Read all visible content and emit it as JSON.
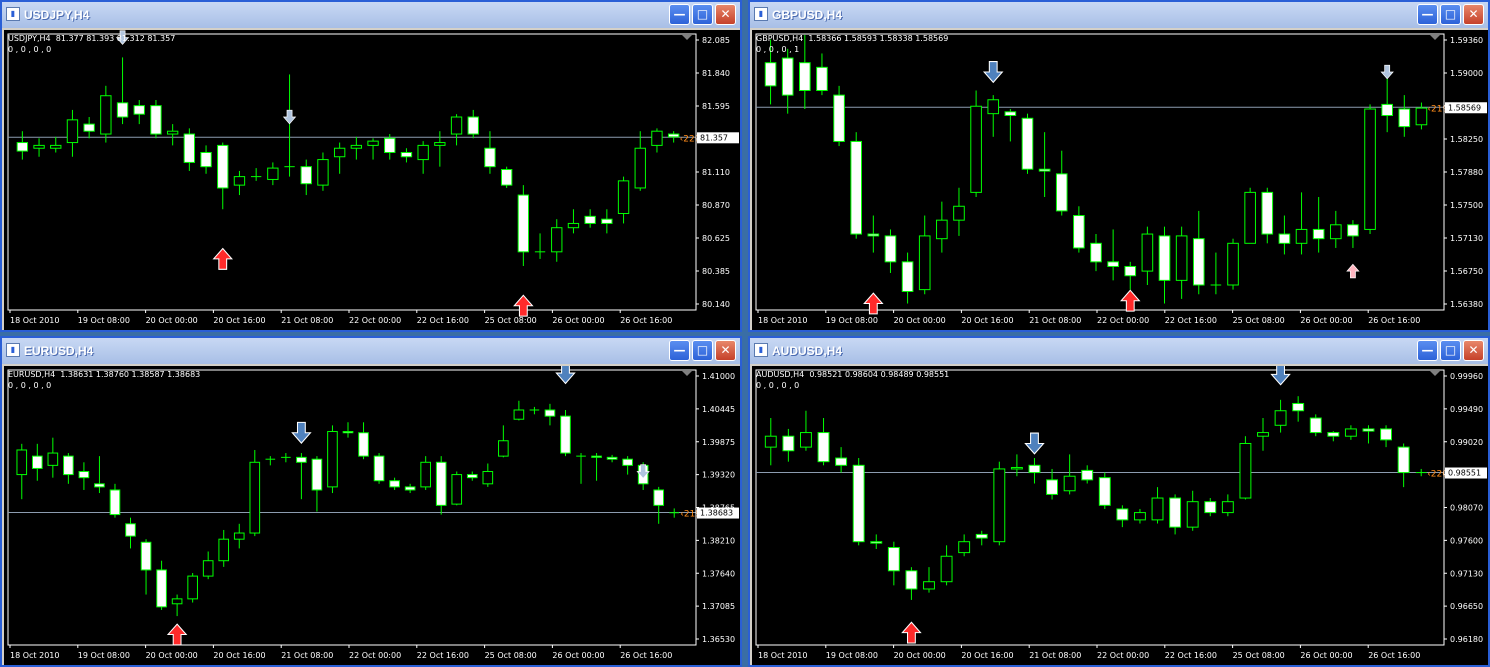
{
  "windows": [
    {
      "title": "USDJPY,H4",
      "symbol_line": "USDJPY,H4  81.377 81.393 81.312 81.357",
      "indicator_line": "0 , 0 , 0 , 0",
      "yticks": [
        "82.085",
        "81.840",
        "81.595",
        "81.350",
        "81.110",
        "80.870",
        "80.625",
        "80.385",
        "80.140"
      ],
      "ymin": 80.14,
      "ymax": 82.085,
      "price_label": "81.357",
      "price": 81.357,
      "timer": "220:00",
      "xticks": [
        "18 Oct 2010",
        "19 Oct 08:00",
        "20 Oct 00:00",
        "20 Oct 16:00",
        "21 Oct 08:00",
        "22 Oct 00:00",
        "22 Oct 16:00",
        "25 Oct 08:00",
        "26 Oct 00:00",
        "26 Oct 16:00"
      ],
      "candles": [
        [
          81.32,
          81.26,
          81.4,
          81.2
        ],
        [
          81.28,
          81.3,
          81.35,
          81.22
        ],
        [
          81.28,
          81.3,
          81.36,
          81.25
        ],
        [
          81.32,
          81.48,
          81.55,
          81.22
        ],
        [
          81.45,
          81.4,
          81.5,
          81.35
        ],
        [
          81.38,
          81.65,
          81.72,
          81.32
        ],
        [
          81.6,
          81.5,
          81.92,
          81.45
        ],
        [
          81.58,
          81.52,
          81.62,
          81.45
        ],
        [
          81.58,
          81.38,
          81.62,
          81.35
        ],
        [
          81.38,
          81.4,
          81.45,
          81.3
        ],
        [
          81.38,
          81.18,
          81.42,
          81.12
        ],
        [
          81.25,
          81.15,
          81.3,
          81.1
        ],
        [
          81.3,
          81.0,
          81.32,
          80.85
        ],
        [
          81.02,
          81.08,
          81.12,
          80.95
        ],
        [
          81.08,
          81.08,
          81.14,
          81.05
        ],
        [
          81.06,
          81.14,
          81.18,
          81.02
        ],
        [
          81.15,
          81.15,
          81.8,
          81.08
        ],
        [
          81.15,
          81.03,
          81.2,
          80.95
        ],
        [
          81.02,
          81.2,
          81.25,
          80.98
        ],
        [
          81.22,
          81.28,
          81.32,
          81.1
        ],
        [
          81.28,
          81.3,
          81.36,
          81.2
        ],
        [
          81.3,
          81.33,
          81.35,
          81.2
        ],
        [
          81.35,
          81.25,
          81.38,
          81.2
        ],
        [
          81.25,
          81.22,
          81.28,
          81.18
        ],
        [
          81.2,
          81.3,
          81.33,
          81.1
        ],
        [
          81.3,
          81.32,
          81.4,
          81.15
        ],
        [
          81.38,
          81.5,
          81.52,
          81.3
        ],
        [
          81.5,
          81.38,
          81.55,
          81.35
        ],
        [
          81.28,
          81.15,
          81.4,
          81.1
        ],
        [
          81.13,
          81.02,
          81.15,
          81.0
        ],
        [
          80.95,
          80.55,
          81.02,
          80.45
        ],
        [
          80.55,
          80.55,
          80.68,
          80.5
        ],
        [
          80.55,
          80.72,
          80.78,
          80.48
        ],
        [
          80.72,
          80.75,
          80.85,
          80.68
        ],
        [
          80.8,
          80.75,
          80.85,
          80.72
        ],
        [
          80.78,
          80.75,
          80.85,
          80.68
        ],
        [
          80.82,
          81.05,
          81.08,
          80.75
        ],
        [
          81.0,
          81.28,
          81.4,
          80.98
        ],
        [
          81.3,
          81.4,
          81.42,
          81.25
        ],
        [
          81.38,
          81.36,
          81.4,
          81.32
        ]
      ],
      "arrows": [
        {
          "i": 6,
          "dir": "down",
          "color": "#b0c4de",
          "big": false,
          "p": 82.06
        },
        {
          "i": 16,
          "dir": "down",
          "color": "#b0c4de",
          "big": false,
          "p": 81.5
        },
        {
          "i": 12,
          "dir": "up",
          "color": "#ff2a2a",
          "big": true,
          "p": 80.5
        },
        {
          "i": 30,
          "dir": "up",
          "color": "#ff2a2a",
          "big": true,
          "p": 80.17
        }
      ]
    },
    {
      "title": "GBPUSD,H4",
      "symbol_line": "GBPUSD,H4  1.58366 1.58593 1.58338 1.58569",
      "indicator_line": "0 , 0 , 0 , 1",
      "yticks": [
        "1.59360",
        "1.59000",
        "1.58569",
        "1.58250",
        "1.57880",
        "1.57500",
        "1.57130",
        "1.56750",
        "1.56380"
      ],
      "ymin": 1.5638,
      "ymax": 1.5936,
      "price_label": "1.58569",
      "price": 1.58569,
      "timer": "219:59",
      "xticks": [
        "18 Oct 2010",
        "19 Oct 08:00",
        "20 Oct 00:00",
        "20 Oct 16:00",
        "21 Oct 08:00",
        "22 Oct 00:00",
        "22 Oct 16:00",
        "25 Oct 08:00",
        "26 Oct 00:00",
        "26 Oct 16:00"
      ],
      "candles": [
        [
          1.5905,
          1.588,
          1.593,
          1.586
        ],
        [
          1.591,
          1.587,
          1.592,
          1.585
        ],
        [
          1.5905,
          1.5875,
          1.5935,
          1.5855
        ],
        [
          1.59,
          1.5875,
          1.5915,
          1.587
        ],
        [
          1.587,
          1.582,
          1.588,
          1.5815
        ],
        [
          1.582,
          1.572,
          1.583,
          1.5715
        ],
        [
          1.572,
          1.5718,
          1.574,
          1.57
        ],
        [
          1.5718,
          1.569,
          1.5725,
          1.5678
        ],
        [
          1.569,
          1.5658,
          1.57,
          1.5645
        ],
        [
          1.566,
          1.5718,
          1.574,
          1.5655
        ],
        [
          1.5715,
          1.5735,
          1.5755,
          1.57
        ],
        [
          1.5735,
          1.575,
          1.577,
          1.5718
        ],
        [
          1.5765,
          1.5858,
          1.5875,
          1.576
        ],
        [
          1.585,
          1.5865,
          1.587,
          1.5825
        ],
        [
          1.5852,
          1.5848,
          1.5855,
          1.582
        ],
        [
          1.5845,
          1.579,
          1.585,
          1.5785
        ],
        [
          1.579,
          1.5788,
          1.583,
          1.576
        ],
        [
          1.5785,
          1.5745,
          1.581,
          1.574
        ],
        [
          1.574,
          1.5705,
          1.575,
          1.57
        ],
        [
          1.571,
          1.569,
          1.572,
          1.568
        ],
        [
          1.569,
          1.5685,
          1.5725,
          1.567
        ],
        [
          1.5685,
          1.5675,
          1.569,
          1.566
        ],
        [
          1.568,
          1.572,
          1.5728,
          1.5665
        ],
        [
          1.5718,
          1.567,
          1.5728,
          1.5645
        ],
        [
          1.567,
          1.5718,
          1.5728,
          1.565
        ],
        [
          1.5715,
          1.5665,
          1.5745,
          1.5655
        ],
        [
          1.5665,
          1.5665,
          1.57,
          1.5655
        ],
        [
          1.5665,
          1.571,
          1.5715,
          1.566
        ],
        [
          1.571,
          1.5765,
          1.577,
          1.571
        ],
        [
          1.5765,
          1.572,
          1.577,
          1.571
        ],
        [
          1.572,
          1.571,
          1.574,
          1.5698
        ],
        [
          1.571,
          1.5725,
          1.5765,
          1.5698
        ],
        [
          1.5725,
          1.5715,
          1.576,
          1.57
        ],
        [
          1.5715,
          1.573,
          1.5745,
          1.5705
        ],
        [
          1.573,
          1.5718,
          1.5735,
          1.5705
        ],
        [
          1.5725,
          1.5855,
          1.586,
          1.572
        ],
        [
          1.586,
          1.5848,
          1.5895,
          1.583
        ],
        [
          1.5855,
          1.5836,
          1.587,
          1.5825
        ],
        [
          1.5838,
          1.5856,
          1.5862,
          1.5833
        ]
      ],
      "arrows": [
        {
          "i": 13,
          "dir": "down",
          "color": "#4f81bd",
          "big": true,
          "p": 1.5895
        },
        {
          "i": 36,
          "dir": "down",
          "color": "#b0c4de",
          "big": false,
          "p": 1.5895
        },
        {
          "i": 6,
          "dir": "up",
          "color": "#ff2a2a",
          "big": true,
          "p": 1.5645
        },
        {
          "i": 21,
          "dir": "up",
          "color": "#ff2a2a",
          "big": true,
          "p": 1.5648
        },
        {
          "i": 34,
          "dir": "up",
          "color": "#ffb6c1",
          "big": false,
          "p": 1.568
        }
      ]
    },
    {
      "title": "EURUSD,H4",
      "symbol_line": "EURUSD,H4  1.38631 1.38760 1.38587 1.38683",
      "indicator_line": "0 , 0 , 0 , 0",
      "yticks": [
        "1.41000",
        "1.40445",
        "1.39875",
        "1.39320",
        "1.38765",
        "1.38210",
        "1.37640",
        "1.37085",
        "1.36530"
      ],
      "ymin": 1.3653,
      "ymax": 1.41,
      "price_label": "1.38683",
      "price": 1.38683,
      "timer": "219:59",
      "xticks": [
        "18 Oct 2010",
        "19 Oct 08:00",
        "20 Oct 00:00",
        "20 Oct 16:00",
        "21 Oct 08:00",
        "22 Oct 00:00",
        "22 Oct 16:00",
        "25 Oct 08:00",
        "26 Oct 00:00",
        "26 Oct 16:00"
      ],
      "candles": [
        [
          1.393,
          1.397,
          1.398,
          1.389
        ],
        [
          1.396,
          1.394,
          1.398,
          1.392
        ],
        [
          1.3945,
          1.3965,
          1.399,
          1.3925
        ],
        [
          1.396,
          1.393,
          1.3965,
          1.3915
        ],
        [
          1.3935,
          1.3925,
          1.395,
          1.3905
        ],
        [
          1.3915,
          1.391,
          1.396,
          1.39
        ],
        [
          1.3905,
          1.3865,
          1.3915,
          1.386
        ],
        [
          1.385,
          1.383,
          1.386,
          1.381
        ],
        [
          1.382,
          1.3775,
          1.3825,
          1.3735
        ],
        [
          1.3775,
          1.3715,
          1.379,
          1.371
        ],
        [
          1.372,
          1.3728,
          1.3735,
          1.37
        ],
        [
          1.3728,
          1.3765,
          1.377,
          1.3722
        ],
        [
          1.3765,
          1.379,
          1.3805,
          1.376
        ],
        [
          1.379,
          1.3825,
          1.384,
          1.378
        ],
        [
          1.3825,
          1.3835,
          1.385,
          1.381
        ],
        [
          1.3835,
          1.395,
          1.397,
          1.383
        ],
        [
          1.3955,
          1.3955,
          1.396,
          1.3945
        ],
        [
          1.3958,
          1.3958,
          1.3965,
          1.395
        ],
        [
          1.3958,
          1.395,
          1.3965,
          1.389
        ],
        [
          1.3955,
          1.3905,
          1.396,
          1.387
        ],
        [
          1.391,
          1.4,
          1.401,
          1.39
        ],
        [
          1.4,
          1.3998,
          1.4015,
          1.399
        ],
        [
          1.3998,
          1.396,
          1.4015,
          1.3955
        ],
        [
          1.396,
          1.392,
          1.3965,
          1.3915
        ],
        [
          1.392,
          1.391,
          1.3925,
          1.3905
        ],
        [
          1.391,
          1.3905,
          1.3915,
          1.39
        ],
        [
          1.391,
          1.395,
          1.396,
          1.3905
        ],
        [
          1.395,
          1.388,
          1.396,
          1.3865
        ],
        [
          1.3882,
          1.393,
          1.3935,
          1.388
        ],
        [
          1.393,
          1.3925,
          1.3935,
          1.392
        ],
        [
          1.3915,
          1.3935,
          1.3948,
          1.391
        ],
        [
          1.396,
          1.3985,
          1.401,
          1.3958
        ],
        [
          1.402,
          1.4035,
          1.405,
          1.4018
        ],
        [
          1.4035,
          1.4035,
          1.404,
          1.4028
        ],
        [
          1.4035,
          1.4025,
          1.4045,
          1.401
        ],
        [
          1.4025,
          1.3965,
          1.4035,
          1.396
        ],
        [
          1.396,
          1.396,
          1.3965,
          1.3915
        ],
        [
          1.396,
          1.3958,
          1.3965,
          1.392
        ],
        [
          1.3958,
          1.3955,
          1.3962,
          1.395
        ],
        [
          1.3955,
          1.3945,
          1.396,
          1.393
        ],
        [
          1.3945,
          1.3915,
          1.395,
          1.3905
        ],
        [
          1.3905,
          1.388,
          1.391,
          1.385
        ],
        [
          1.3868,
          1.3868,
          1.3875,
          1.386
        ]
      ],
      "arrows": [
        {
          "i": 18,
          "dir": "down",
          "color": "#4f81bd",
          "big": true,
          "p": 1.3998
        },
        {
          "i": 35,
          "dir": "down",
          "color": "#4f81bd",
          "big": true,
          "p": 1.4095
        },
        {
          "i": 40,
          "dir": "down",
          "color": "#b0c4de",
          "big": false,
          "p": 1.3935
        },
        {
          "i": 10,
          "dir": "up",
          "color": "#ff2a2a",
          "big": true,
          "p": 1.367
        }
      ]
    },
    {
      "title": "AUDUSD,H4",
      "symbol_line": "AUDUSD,H4  0.98521 0.98604 0.98489 0.98551",
      "indicator_line": "0 , 0 , 0 , 0",
      "yticks": [
        "0.99960",
        "0.99490",
        "0.99020",
        "0.98551",
        "0.98070",
        "0.97600",
        "0.97130",
        "0.96650",
        "0.96180"
      ],
      "ymin": 0.9618,
      "ymax": 0.9996,
      "price_label": "0.98551",
      "price": 0.98551,
      "timer": "220:00",
      "xticks": [
        "18 Oct 2010",
        "19 Oct 08:00",
        "20 Oct 00:00",
        "20 Oct 16:00",
        "21 Oct 08:00",
        "22 Oct 00:00",
        "22 Oct 16:00",
        "25 Oct 08:00",
        "26 Oct 00:00",
        "26 Oct 16:00"
      ],
      "candles": [
        [
          0.989,
          0.9905,
          0.993,
          0.9865
        ],
        [
          0.9905,
          0.9885,
          0.9915,
          0.987
        ],
        [
          0.989,
          0.991,
          0.994,
          0.9885
        ],
        [
          0.991,
          0.987,
          0.993,
          0.9865
        ],
        [
          0.9875,
          0.9865,
          0.989,
          0.9855
        ],
        [
          0.9865,
          0.976,
          0.9875,
          0.9755
        ],
        [
          0.976,
          0.9758,
          0.977,
          0.975
        ],
        [
          0.9752,
          0.972,
          0.976,
          0.97
        ],
        [
          0.972,
          0.9695,
          0.9725,
          0.968
        ],
        [
          0.9695,
          0.9705,
          0.9725,
          0.969
        ],
        [
          0.9705,
          0.974,
          0.9755,
          0.97
        ],
        [
          0.9745,
          0.976,
          0.977,
          0.974
        ],
        [
          0.977,
          0.9765,
          0.9775,
          0.9755
        ],
        [
          0.976,
          0.986,
          0.987,
          0.9755
        ],
        [
          0.986,
          0.9862,
          0.988,
          0.985
        ],
        [
          0.9865,
          0.9855,
          0.9875,
          0.984
        ],
        [
          0.9845,
          0.9825,
          0.986,
          0.9818
        ],
        [
          0.983,
          0.985,
          0.988,
          0.9825
        ],
        [
          0.9858,
          0.9845,
          0.9865,
          0.984
        ],
        [
          0.9848,
          0.981,
          0.9855,
          0.9805
        ],
        [
          0.9805,
          0.979,
          0.981,
          0.978
        ],
        [
          0.979,
          0.98,
          0.9805,
          0.9785
        ],
        [
          0.979,
          0.982,
          0.9835,
          0.9785
        ],
        [
          0.982,
          0.978,
          0.9825,
          0.977
        ],
        [
          0.978,
          0.9815,
          0.983,
          0.9775
        ],
        [
          0.9815,
          0.98,
          0.982,
          0.9795
        ],
        [
          0.98,
          0.9815,
          0.9825,
          0.9795
        ],
        [
          0.982,
          0.9895,
          0.9905,
          0.9818
        ],
        [
          0.9905,
          0.991,
          0.993,
          0.9885
        ],
        [
          0.992,
          0.994,
          0.9955,
          0.991
        ],
        [
          0.995,
          0.994,
          0.996,
          0.9925
        ],
        [
          0.993,
          0.991,
          0.9935,
          0.9905
        ],
        [
          0.991,
          0.9905,
          0.9912,
          0.9898
        ],
        [
          0.9905,
          0.9915,
          0.992,
          0.99
        ],
        [
          0.9915,
          0.9912,
          0.992,
          0.9895
        ],
        [
          0.9915,
          0.99,
          0.992,
          0.989
        ],
        [
          0.989,
          0.9855,
          0.9895,
          0.9835
        ],
        [
          0.9855,
          0.9855,
          0.986,
          0.985
        ]
      ],
      "arrows": [
        {
          "i": 15,
          "dir": "down",
          "color": "#4f81bd",
          "big": true,
          "p": 0.9895
        },
        {
          "i": 29,
          "dir": "down",
          "color": "#4f81bd",
          "big": true,
          "p": 0.999
        },
        {
          "i": 8,
          "dir": "up",
          "color": "#ff2a2a",
          "big": true,
          "p": 0.9635
        }
      ]
    }
  ]
}
